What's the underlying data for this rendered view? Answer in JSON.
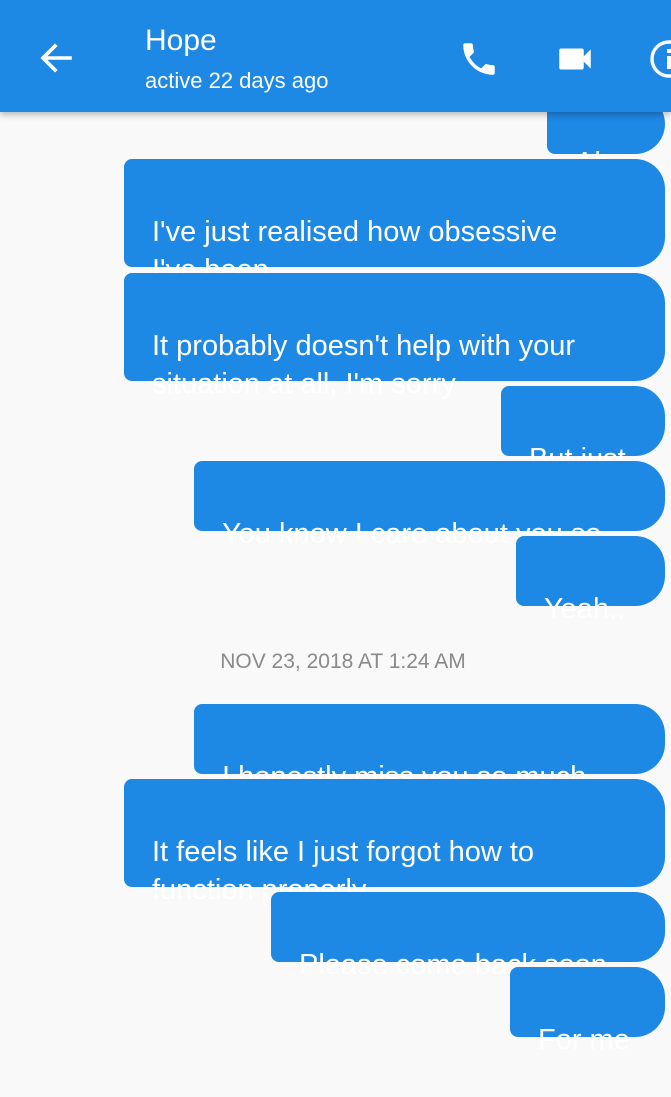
{
  "header": {
    "name": "Hope",
    "status": "active 22 days ago",
    "bar_color": "#1e88e5",
    "icons": [
      "back-arrow-icon",
      "phone-icon",
      "video-camera-icon",
      "info-icon"
    ]
  },
  "messages": [
    {
      "text": "Ah.."
    },
    {
      "text": "I've just realised how obsessive\nI've been"
    },
    {
      "text": "It probably doesn't help with your\nsituation at all, I'm sorry"
    },
    {
      "text": "But just"
    },
    {
      "text": "You know I care about you so"
    },
    {
      "text": "Yeah.."
    },
    {
      "text": "I honestly miss you so much"
    },
    {
      "text": "It feels like I just forgot how to\nfunction properly"
    },
    {
      "text": "Please come back soon"
    },
    {
      "text": "For me"
    }
  ],
  "timestamp": "NOV 23, 2018 AT 1:24 AM"
}
